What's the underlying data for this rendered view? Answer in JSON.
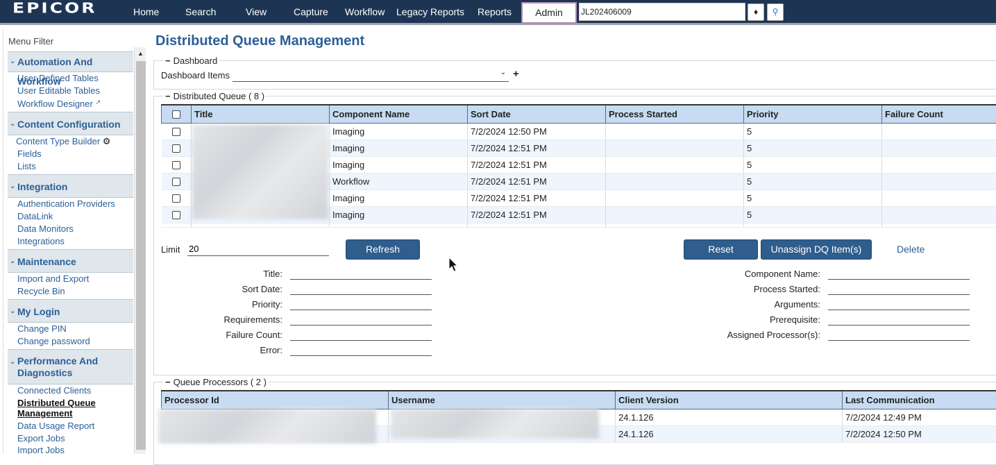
{
  "brand": "EPICOR",
  "nav": {
    "items": [
      "Home",
      "Search",
      "View",
      "Capture",
      "Workflow",
      "Legacy Reports",
      "Reports"
    ],
    "admin_label": "Admin",
    "search_value": "JL202406009"
  },
  "sidebar": {
    "filter_label": "Menu Filter",
    "sections": [
      {
        "title": "Automation And Workflow",
        "items": [
          "User Defined Tables",
          "User Editable Tables",
          "Workflow Designer"
        ]
      },
      {
        "title": "Content Configuration",
        "items": [
          "Content Type Builder",
          "Fields",
          "Lists"
        ]
      },
      {
        "title": "Integration",
        "items": [
          "Authentication Providers",
          "DataLink",
          "Data Monitors",
          "Integrations"
        ]
      },
      {
        "title": "Maintenance",
        "items": [
          "Import and Export",
          "Recycle Bin"
        ]
      },
      {
        "title": "My Login",
        "items": [
          "Change PIN",
          "Change password"
        ]
      },
      {
        "title": "Performance And Diagnostics",
        "items": [
          "Connected Clients",
          "Distributed Queue Management",
          "Data Usage Report",
          "Export Jobs",
          "Import Jobs"
        ]
      }
    ]
  },
  "page": {
    "title": "Distributed Queue Management"
  },
  "dashboard": {
    "legend": "Dashboard",
    "items_label": "Dashboard Items",
    "selected": ""
  },
  "queue": {
    "legend": "Distributed Queue ( 8 )",
    "columns": [
      "Title",
      "Component Name",
      "Sort Date",
      "Process Started",
      "Priority",
      "Failure Count"
    ],
    "rows": [
      {
        "component": "Imaging",
        "sort_date": "7/2/2024 12:50 PM",
        "priority": "5"
      },
      {
        "component": "Imaging",
        "sort_date": "7/2/2024 12:51 PM",
        "priority": "5"
      },
      {
        "component": "Imaging",
        "sort_date": "7/2/2024 12:51 PM",
        "priority": "5"
      },
      {
        "component": "Workflow",
        "sort_date": "7/2/2024 12:51 PM",
        "priority": "5"
      },
      {
        "component": "Imaging",
        "sort_date": "7/2/2024 12:51 PM",
        "priority": "5"
      },
      {
        "component": "Imaging",
        "sort_date": "7/2/2024 12:51 PM",
        "priority": "5"
      }
    ],
    "limit_label": "Limit",
    "limit_value": "20",
    "refresh_label": "Refresh",
    "reset_label": "Reset",
    "unassign_label": "Unassign DQ Item(s)",
    "delete_label": "Delete",
    "form_left": [
      "Title:",
      "Sort Date:",
      "Priority:",
      "Requirements:",
      "Failure Count:",
      "Error:"
    ],
    "form_right": [
      "Component Name:",
      "Process Started:",
      "Arguments:",
      "Prerequisite:",
      "Assigned Processor(s):"
    ]
  },
  "processors": {
    "legend": "Queue Processors ( 2 )",
    "columns": [
      "Processor Id",
      "Username",
      "Client Version",
      "Last Communication"
    ],
    "rows": [
      {
        "client_version": "24.1.126",
        "last_comm": "7/2/2024 12:49 PM"
      },
      {
        "client_version": "24.1.126",
        "last_comm": "7/2/2024 12:50 PM"
      }
    ]
  }
}
